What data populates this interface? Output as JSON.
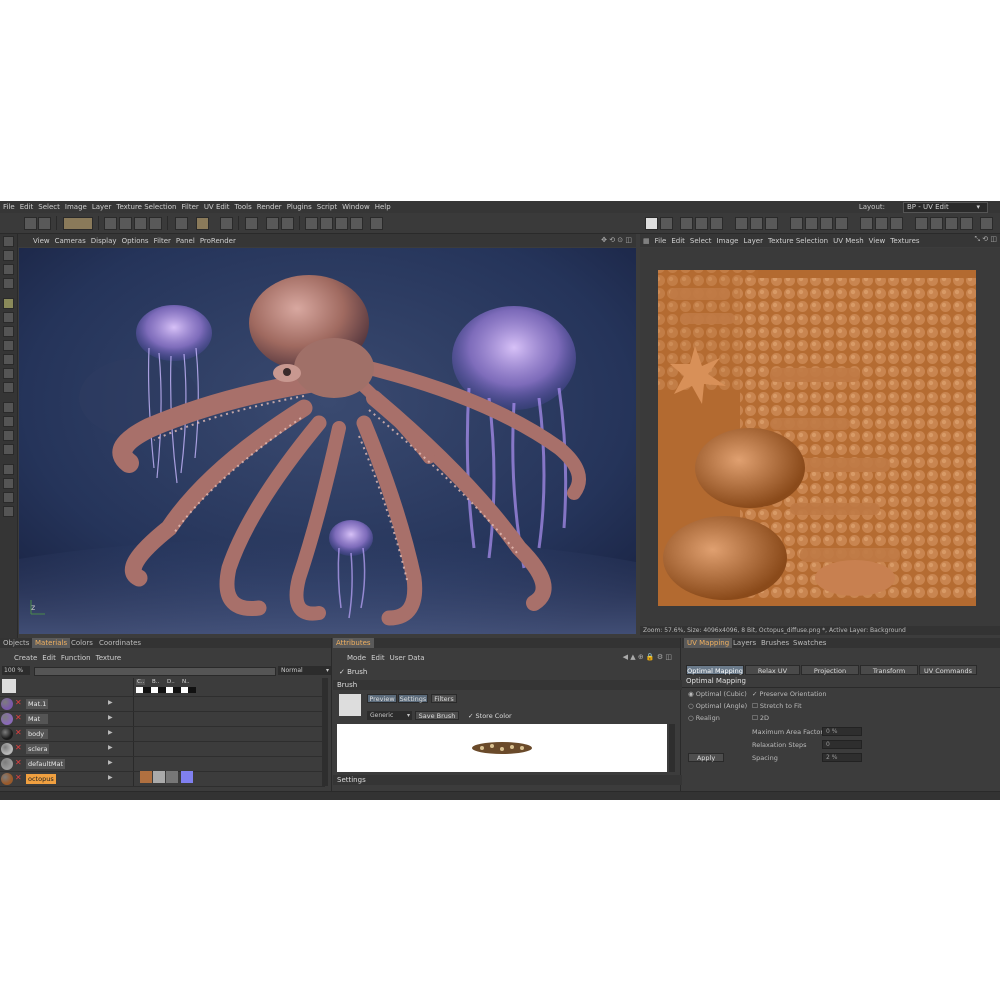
{
  "menubar": {
    "items": [
      "File",
      "Edit",
      "Select",
      "Image",
      "Layer",
      "Texture Selection",
      "Filter",
      "UV Edit",
      "Tools",
      "Render",
      "Plugins",
      "Script",
      "Window",
      "Help"
    ],
    "layout_label": "Layout:",
    "layout_value": "BP - UV Edit"
  },
  "viewport": {
    "menu": [
      "View",
      "Cameras",
      "Display",
      "Options",
      "Filter",
      "Panel",
      "ProRender"
    ],
    "axis_label": "z"
  },
  "texture_view": {
    "menu": [
      "File",
      "Edit",
      "Select",
      "Image",
      "Layer",
      "Texture Selection",
      "UV Mesh",
      "View",
      "Textures"
    ],
    "status": "Zoom: 57.6%, Size: 4096x4096, 8 Bit, Octopus_diffuse.png *, Active Layer: Background"
  },
  "materials_panel": {
    "tabs": [
      "Objects",
      "Materials",
      "Colors",
      "Coordinates"
    ],
    "active_tab": "Materials",
    "menu": [
      "Create",
      "Edit",
      "Function",
      "Texture"
    ],
    "zoom_value": "100 %",
    "blend_mode": "Normal",
    "column_headers": [
      "C..",
      "B..",
      "D..",
      "N.."
    ],
    "materials": [
      {
        "name": "Mat.1",
        "color": "#7a5aa8"
      },
      {
        "name": "Mat",
        "color": "#8a6ab8"
      },
      {
        "name": "body",
        "color": "#1a1a1a"
      },
      {
        "name": "sclera",
        "color": "#b8b8b8"
      },
      {
        "name": "defaultMat",
        "color": "#9a9a9a"
      },
      {
        "name": "octopus",
        "color": "#9a5a2a"
      }
    ]
  },
  "attributes_panel": {
    "tab": "Attributes",
    "menu": [
      "Mode",
      "Edit",
      "User Data"
    ],
    "brush_tool": "Brush",
    "section_title": "Brush",
    "subtabs": [
      "Preview",
      "Settings",
      "Filters"
    ],
    "preset": "Generic",
    "save_button": "Save Brush",
    "store_color_label": "Store Color",
    "footer_section": "Settings"
  },
  "uv_panel": {
    "tabs": [
      "UV Mapping",
      "Layers",
      "Brushes",
      "Swatches"
    ],
    "active_tab": "UV Mapping",
    "subtabs": [
      "Optimal Mapping",
      "Relax UV",
      "Projection",
      "Transform",
      "UV Commands"
    ],
    "section_title": "Optimal Mapping",
    "radio_options": [
      "Optimal (Cubic)",
      "Optimal (Angle)",
      "Realign"
    ],
    "checkboxes": [
      {
        "label": "Preserve Orientation",
        "checked": true
      },
      {
        "label": "Stretch to Fit",
        "checked": false
      },
      {
        "label": "2D",
        "checked": false
      }
    ],
    "fields": [
      {
        "label": "Maximum Area Factor",
        "value": "0 %"
      },
      {
        "label": "Relaxation Steps",
        "value": "0"
      },
      {
        "label": "Spacing",
        "value": "2 %"
      }
    ],
    "apply_button": "Apply"
  },
  "colors": {
    "accent": "#f0a040",
    "viewport_bg": "#2a3a5a",
    "uv_bg": "#b36a30"
  }
}
